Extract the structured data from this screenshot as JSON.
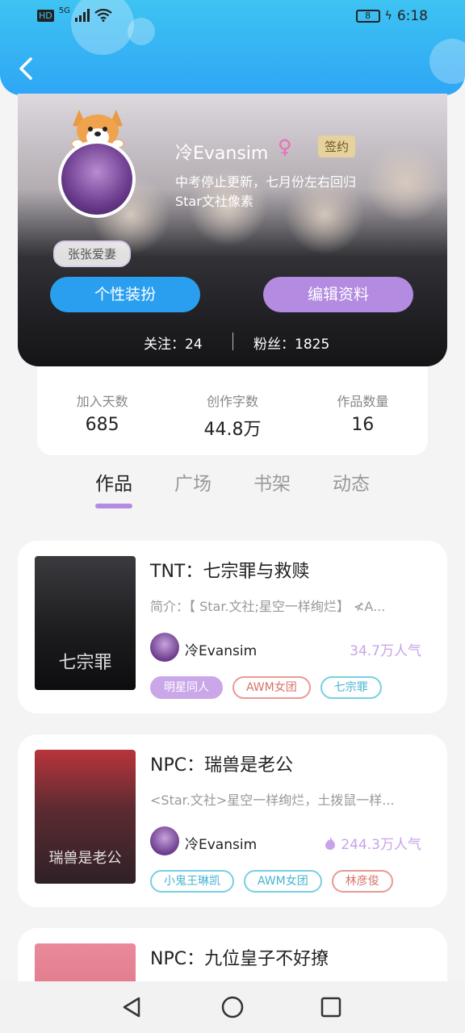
{
  "status_bar": {
    "left_label": "HD",
    "network": "5G",
    "battery": "8",
    "time": "6:18"
  },
  "profile": {
    "nickname": "冷Evansim",
    "gender_symbol": "♀",
    "sign_badge": "签约",
    "bio_line1": "中考停止更新，七月份左右回归",
    "bio_line2": "Star文社像素",
    "avatar_badge": "张张爱妻",
    "button_dress": "个性装扮",
    "button_edit": "编辑资料",
    "follow_label": "关注：24",
    "fans_label": "粉丝：1825"
  },
  "stats": [
    {
      "label": "加入天数",
      "value": "685"
    },
    {
      "label": "创作字数",
      "value": "44.8万"
    },
    {
      "label": "作品数量",
      "value": "16"
    }
  ],
  "tabs": [
    {
      "label": "作品",
      "active": true
    },
    {
      "label": "广场",
      "active": false
    },
    {
      "label": "书架",
      "active": false
    },
    {
      "label": "动态",
      "active": false
    }
  ],
  "works": [
    {
      "title": "TNT：七宗罪与救赎",
      "desc": "简介：【 Star.文社;星空一样绚烂】 ≮A...",
      "author": "冷Evansim",
      "popularity": "34.7万人气",
      "cover_text": "七宗罪",
      "tags": [
        "明星同人",
        "AWM女团",
        "七宗罪"
      ]
    },
    {
      "title": "NPC：瑞兽是老公",
      "desc": "<Star.文社>星空一样绚烂，土拨鼠一样...",
      "author": "冷Evansim",
      "popularity": "244.3万人气",
      "cover_text": "瑞兽是老公",
      "tags": [
        "小鬼王琳凯",
        "AWM女团",
        "林彦俊"
      ]
    },
    {
      "title": "NPC：九位皇子不好撩"
    }
  ],
  "colors": {
    "header_blue": "#2ea6f5",
    "accent_purple": "#b38be0",
    "button_blue": "#2a9ff0"
  }
}
